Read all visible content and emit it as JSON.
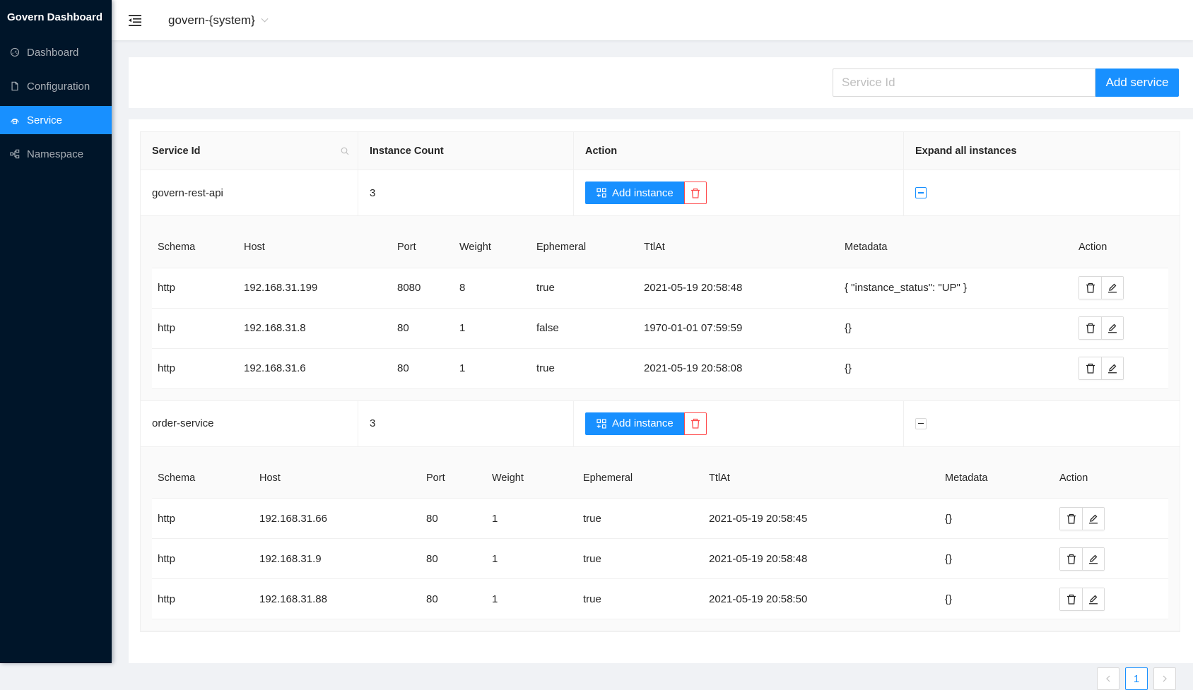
{
  "app": {
    "title": "Govern Dashboard"
  },
  "sidebar": {
    "items": [
      {
        "label": "Dashboard",
        "icon": "dashboard-icon",
        "active": false
      },
      {
        "label": "Configuration",
        "icon": "file-icon",
        "active": false
      },
      {
        "label": "Service",
        "icon": "cloud-server-icon",
        "active": true
      },
      {
        "label": "Namespace",
        "icon": "cluster-icon",
        "active": false
      }
    ]
  },
  "header": {
    "namespace": "govern-{system}"
  },
  "toolbar": {
    "search_placeholder": "Service Id",
    "search_value": "",
    "add_service_label": "Add service"
  },
  "colors": {
    "primary": "#1890ff",
    "danger": "#ff4d4f",
    "sidebar_bg": "#001529"
  },
  "table": {
    "columns": [
      "Service Id",
      "Instance Count",
      "Action",
      "Expand all instances"
    ],
    "add_instance_label": "Add instance",
    "instance_columns": [
      "Schema",
      "Host",
      "Port",
      "Weight",
      "Ephemeral",
      "TtlAt",
      "Metadata",
      "Action"
    ],
    "services": [
      {
        "id": "govern-rest-api",
        "instance_count": "3",
        "expanded": true,
        "instances": [
          {
            "schema": "http",
            "host": "192.168.31.199",
            "port": "8080",
            "weight": "8",
            "ephemeral": "true",
            "ttl_at": "2021-05-19 20:58:48",
            "metadata": "{ \"instance_status\": \"UP\" }"
          },
          {
            "schema": "http",
            "host": "192.168.31.8",
            "port": "80",
            "weight": "1",
            "ephemeral": "false",
            "ttl_at": "1970-01-01 07:59:59",
            "metadata": "{}"
          },
          {
            "schema": "http",
            "host": "192.168.31.6",
            "port": "80",
            "weight": "1",
            "ephemeral": "true",
            "ttl_at": "2021-05-19 20:58:08",
            "metadata": "{}"
          }
        ]
      },
      {
        "id": "order-service",
        "instance_count": "3",
        "expanded": true,
        "instances": [
          {
            "schema": "http",
            "host": "192.168.31.66",
            "port": "80",
            "weight": "1",
            "ephemeral": "true",
            "ttl_at": "2021-05-19 20:58:45",
            "metadata": "{}"
          },
          {
            "schema": "http",
            "host": "192.168.31.9",
            "port": "80",
            "weight": "1",
            "ephemeral": "true",
            "ttl_at": "2021-05-19 20:58:48",
            "metadata": "{}"
          },
          {
            "schema": "http",
            "host": "192.168.31.88",
            "port": "80",
            "weight": "1",
            "ephemeral": "true",
            "ttl_at": "2021-05-19 20:58:50",
            "metadata": "{}"
          }
        ]
      }
    ]
  },
  "pagination": {
    "current_page": "1"
  }
}
